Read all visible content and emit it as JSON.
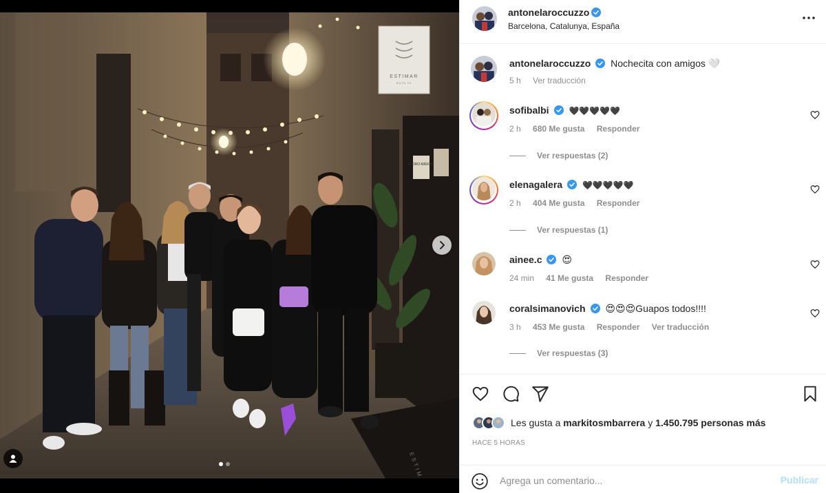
{
  "post": {
    "author": "antonelaroccuzzo",
    "location": "Barcelona, Catalunya, España",
    "caption": "Nochecita con amigos 🤍",
    "caption_time": "5 h",
    "caption_translate": "Ver traducción"
  },
  "photo": {
    "sign_text": "ESTIMAR",
    "sign_subtext": "RATA 29",
    "door_sign_1": "AFORO MÁXIMO",
    "door_sign_2": "",
    "mat_text": "ESTIMAR",
    "carousel_dots": 2,
    "active_dot": 0
  },
  "comments": [
    {
      "user": "sofibalbi",
      "text": "🖤🖤🖤🖤🖤",
      "time": "2 h",
      "likes": "680 Me gusta",
      "reply": "Responder",
      "view_replies": "Ver respuestas (2)"
    },
    {
      "user": "elenagalera",
      "text": "🖤🖤🖤🖤🖤",
      "time": "2 h",
      "likes": "404 Me gusta",
      "reply": "Responder",
      "view_replies": "Ver respuestas (1)"
    },
    {
      "user": "ainee.c",
      "text": "😍",
      "time": "24 min",
      "likes": "41 Me gusta",
      "reply": "Responder"
    },
    {
      "user": "coralsimanovich",
      "text": "😍😍😍Guapos todos!!!!",
      "time": "3 h",
      "likes": "453 Me gusta",
      "reply": "Responder",
      "translate": "Ver traducción",
      "view_replies": "Ver respuestas (3)"
    }
  ],
  "likes": {
    "prefix": "Les gusta a",
    "first_user": "markitosmbarrera",
    "connector": "y",
    "rest": "1.450.795 personas más"
  },
  "time_ago": "HACE 5 HORAS",
  "add_comment": {
    "placeholder": "Agrega un comentario...",
    "publish": "Publicar"
  },
  "colors": {
    "verified": "#3897f0",
    "publish_disabled": "#b2dffc",
    "muted_text": "#8e8e8e"
  }
}
